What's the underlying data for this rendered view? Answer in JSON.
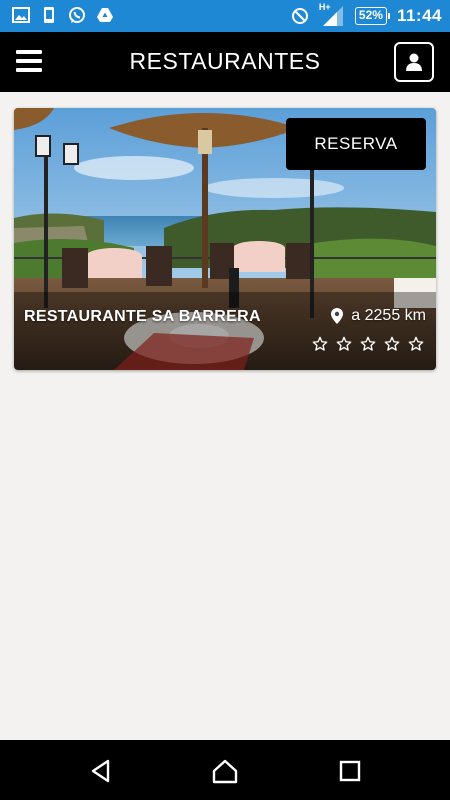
{
  "status_bar": {
    "time": "11:44",
    "battery": "52%",
    "network": "H+",
    "icons": [
      "image-icon",
      "phone-icon",
      "whatsapp-icon",
      "drive-icon",
      "do-not-disturb-icon",
      "signal-icon"
    ]
  },
  "app_bar": {
    "title": "RESTAURANTES",
    "menu_icon": "hamburger-icon",
    "profile_icon": "user-icon"
  },
  "restaurants": [
    {
      "name": "RESTAURANTE SA BARRERA",
      "distance": "a 2255 km",
      "reserve_label": "RESERVA",
      "rating": 0,
      "max_rating": 5
    }
  ],
  "nav_bar": {
    "icons": [
      "back-icon",
      "home-icon",
      "recents-icon"
    ]
  },
  "colors": {
    "status_bar": "#1e88d4",
    "app_bar": "#000000",
    "background": "#f3f2f0"
  }
}
